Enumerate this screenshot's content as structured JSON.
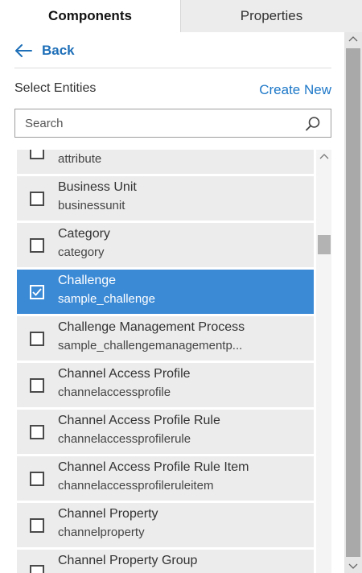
{
  "tabs": {
    "components": "Components",
    "properties": "Properties"
  },
  "nav": {
    "back_label": "Back"
  },
  "entities": {
    "label": "Select Entities",
    "create_new": "Create New"
  },
  "search": {
    "placeholder": "Search"
  },
  "list": {
    "items": [
      {
        "title": "",
        "sub": "attribute",
        "checked": false
      },
      {
        "title": "Business Unit",
        "sub": "businessunit",
        "checked": false
      },
      {
        "title": "Category",
        "sub": "category",
        "checked": false
      },
      {
        "title": "Challenge",
        "sub": "sample_challenge",
        "checked": true
      },
      {
        "title": "Challenge Management Process",
        "sub": "sample_challengemanagementp...",
        "checked": false
      },
      {
        "title": "Channel Access Profile",
        "sub": "channelaccessprofile",
        "checked": false
      },
      {
        "title": "Channel Access Profile Rule",
        "sub": "channelaccessprofilerule",
        "checked": false
      },
      {
        "title": "Channel Access Profile Rule Item",
        "sub": "channelaccessprofileruleitem",
        "checked": false
      },
      {
        "title": "Channel Property",
        "sub": "channelproperty",
        "checked": false
      },
      {
        "title": "Channel Property Group",
        "sub": "",
        "checked": false
      }
    ]
  },
  "colors": {
    "accent": "#1e78c8",
    "selected_bg": "#3b8ad6",
    "item_bg": "#ececec"
  },
  "icons": {
    "back": "arrow-left-icon",
    "search": "magnifier-icon",
    "check": "checkmark-icon",
    "scroll_up": "chevron-up-icon",
    "scroll_down": "chevron-down-icon"
  }
}
